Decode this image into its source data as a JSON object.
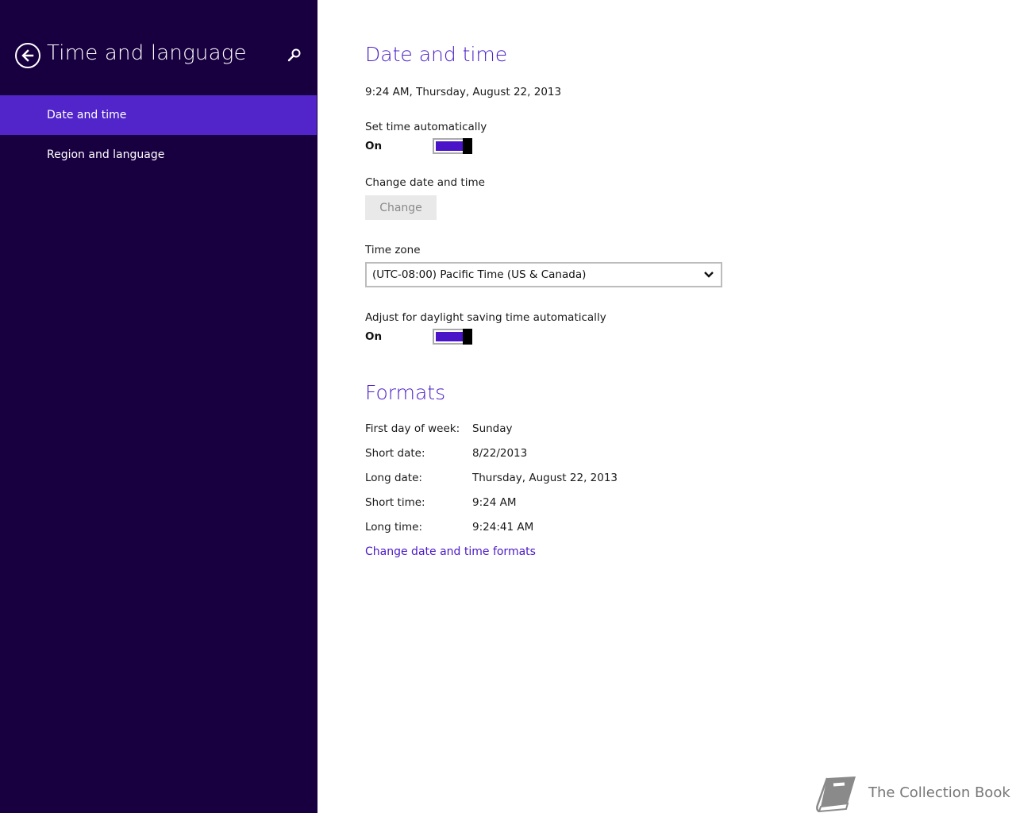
{
  "sidebar": {
    "title": "Time and language",
    "items": [
      {
        "label": "Date and time",
        "active": true
      },
      {
        "label": "Region and language",
        "active": false
      }
    ]
  },
  "date_time": {
    "heading": "Date and time",
    "current": "9:24 AM, Thursday, August 22, 2013",
    "set_auto_label": "Set time automatically",
    "set_auto_state": "On",
    "change_label": "Change date and time",
    "change_button": "Change",
    "timezone_label": "Time zone",
    "timezone_value": "(UTC-08:00) Pacific Time (US & Canada)",
    "dst_label": "Adjust for daylight saving time automatically",
    "dst_state": "On"
  },
  "formats": {
    "heading": "Formats",
    "rows": [
      {
        "label": "First day of week:",
        "value": "Sunday"
      },
      {
        "label": "Short date:",
        "value": "8/22/2013"
      },
      {
        "label": "Long date:",
        "value": "Thursday, August 22, 2013"
      },
      {
        "label": "Short time:",
        "value": "9:24 AM"
      },
      {
        "label": "Long time:",
        "value": "9:24:41 AM"
      }
    ],
    "link": "Change date and time formats"
  },
  "watermark": {
    "text": "The Collection Book"
  },
  "colors": {
    "sidebar_bg": "#180040",
    "sidebar_active": "#5125c9",
    "accent": "#4c21c6",
    "toggle_fill": "#4a13c8"
  }
}
